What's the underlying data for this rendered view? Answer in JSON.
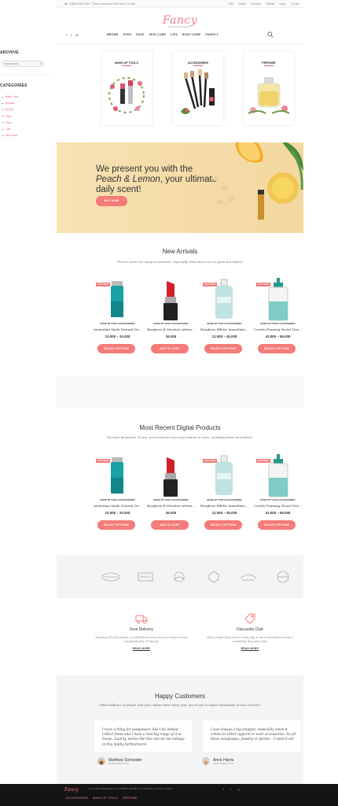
{
  "topbar": {
    "phone": "+1(800) 1234 6756",
    "note": "7 Days a week from 9:00 am to 7:00 pm",
    "currency": "USD",
    "links": [
      "Orders",
      "Compare",
      "Wishlist",
      "Log In",
      "Cart"
    ]
  },
  "logo": {
    "name": "Fancy",
    "tagline": "COSMETIC AND BEAUTY"
  },
  "nav": {
    "items": [
      "BROWS",
      "EYES",
      "FACE",
      "SKIN CARE",
      "LIPS",
      "BODY CARE",
      "PAGES"
    ]
  },
  "sidebar": {
    "archive_title": "ARCHIVE",
    "archive_select": "Select Month",
    "categories_title": "CATEGORIES",
    "categories": [
      "Body Care",
      "Brands",
      "Brows",
      "Eyes",
      "Face",
      "Lips",
      "Skin Care"
    ]
  },
  "categories": [
    {
      "title": "MAKE UP TOOLS"
    },
    {
      "title": "ACCESSORIES"
    },
    {
      "title": "PERFUME"
    }
  ],
  "banner": {
    "line1": "We present you with the",
    "line2_italic": "Peach & Lemon",
    "line2_rest": ", your ultimate",
    "line3": "daily scent!",
    "button": "BUY NOW"
  },
  "new_arrivals": {
    "title": "New Arrivals",
    "subtitle": "There's never too many accessories, especially when these are so good and stylish!",
    "products": [
      {
        "badge": "FEATURED",
        "brand": "MAKE UP TOOLS  ACCESSORIES",
        "name": "Australian Made Natural De...",
        "price": "23.00$ – 34.00$",
        "button": "SELECT OPTIONS"
      },
      {
        "badge": "",
        "brand": "MAKE UP TOOLS  ACCESSORIES",
        "name": "Borghese B Moisture Advan...",
        "price": "36.00$",
        "button": "ADD TO CART"
      },
      {
        "badge": "FEATURED",
        "brand": "MAKE UP TOOLS  ACCESSORIES",
        "name": "Borghese Effetto Immediato...",
        "price": "12.00$ – 45.00$",
        "button": "SELECT OPTIONS"
      },
      {
        "badge": "FEATURED",
        "brand": "MAKE UP TOOLS  ACCESSORIES",
        "name": "CeraVe Foaming Facial Clea...",
        "price": "43.00$ – 56.00$",
        "button": "SELECT OPTIONS"
      }
    ]
  },
  "recent": {
    "title": "Most Recent Digital Products",
    "subtitle": "We have thousands of new accessories for men and women in store, including these bestsellers!",
    "products": [
      {
        "badge": "FEATURED",
        "brand": "MAKE UP TOOLS  ACCESSORIES",
        "name": "Australian Made Natural De...",
        "price": "23.00$ – 34.00$",
        "button": "SELECT OPTIONS"
      },
      {
        "badge": "",
        "brand": "MAKE UP TOOLS  ACCESSORIES",
        "name": "Borghese B Moisture Advan...",
        "price": "36.00$",
        "button": "ADD TO CART"
      },
      {
        "badge": "FEATURED",
        "brand": "MAKE UP TOOLS  ACCESSORIES",
        "name": "Borghese Effetto Immediato...",
        "price": "12.00$ – 45.00$",
        "button": "SELECT OPTIONS"
      },
      {
        "badge": "FEATURED",
        "brand": "MAKE UP TOOLS  ACCESSORIES",
        "name": "CeraVe Foaming Facial Clea...",
        "price": "43.00$ – 56.00$",
        "button": "SELECT OPTIONS"
      }
    ]
  },
  "brand_logos": [
    "Brand 1",
    "Brand 2",
    "Brand 3",
    "Brand 4",
    "Brand 5",
    "Brand 6"
  ],
  "features": [
    {
      "title": "Free Delivery",
      "text": "Ensuring all of its clients, we will deliver every thing we have in truck completely free of charge!",
      "more": "READ MORE"
    },
    {
      "title": "Discounts Club",
      "text": "Many people shop with us every day, so we've decided to create a completely discounts club!",
      "more": "READ MORE"
    }
  ],
  "testimonials": {
    "title": "Happy Customers",
    "subtitle": "When millions of people visit your online store every year, you've got to expect thousands of nice reviews!",
    "items": [
      {
        "quote": "I have a thing for sunglasses, like I do indeed collect these and I have a real big range of it at house. Luckily, stores like this one let me indulge in this hobby furthermore!",
        "name": "Matthew Schneider",
        "role": "RESPONSIBLE BUYER"
      },
      {
        "quote": "I was always a big shopper, especially when it comes to either apparel or even accessories. So all these sunglasses, jewelry or purses – I need it all!",
        "name": "Anne Harris",
        "role": "RESPONSIBLE BUYER"
      }
    ]
  },
  "footer": {
    "logo": "Fancy",
    "copyright": "© ALL RIGHTS RESERVED BY COSMETIC AND BEAUTY STORE 2021 | PRIVACY POLICY",
    "links": [
      "ACCESSORIES",
      "MAKE UP TOOLS",
      "PERFUME"
    ]
  },
  "colors": {
    "accent": "#f47b78",
    "pink": "#f37e8e",
    "banner": "#f6dfad",
    "footer": "#141414"
  }
}
